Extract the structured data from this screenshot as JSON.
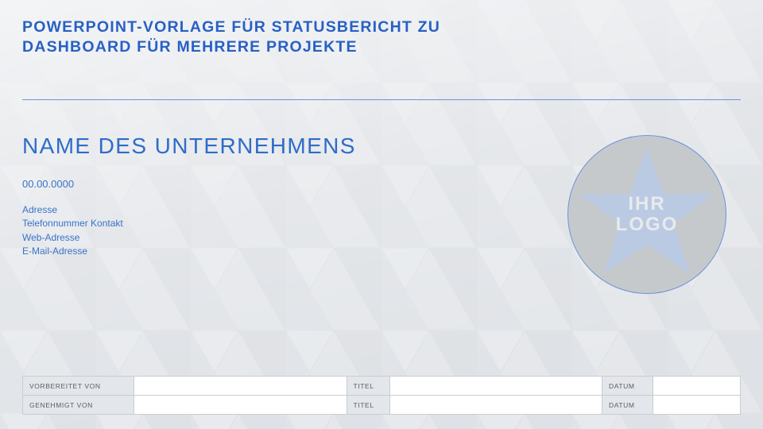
{
  "title_line1": "POWERPOINT-VORLAGE FÜR STATUSBERICHT ZU",
  "title_line2": "DASHBOARD FÜR MEHRERE PROJEKTE",
  "company_name": "NAME DES UNTERNEHMENS",
  "date": "00.00.0000",
  "info": {
    "address": "Adresse",
    "phone": "Telefonnummer Kontakt",
    "web": "Web-Adresse",
    "email": "E-Mail-Adresse"
  },
  "logo": {
    "line1": "IHR",
    "line2": "LOGO"
  },
  "approval": {
    "rows": [
      {
        "label": "VORBEREITET VON",
        "value": "",
        "title_label": "TITEL",
        "title_value": "",
        "date_label": "DATUM",
        "date_value": ""
      },
      {
        "label": "GENEHMIGT VON",
        "value": "",
        "title_label": "TITEL",
        "title_value": "",
        "date_label": "DATUM",
        "date_value": ""
      }
    ]
  },
  "colors": {
    "primary": "#2860c4",
    "background": "#eaecef"
  }
}
